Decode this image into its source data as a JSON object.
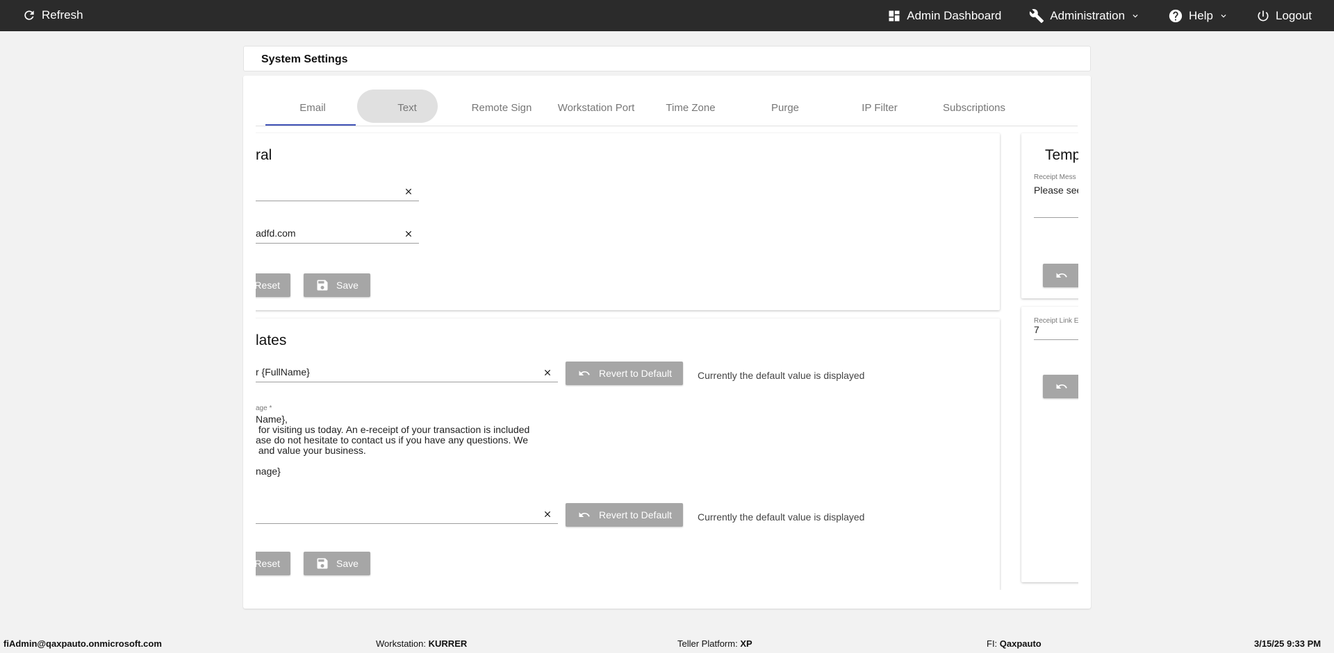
{
  "topbar": {
    "refresh": "Refresh",
    "admin_dashboard": "Admin Dashboard",
    "administration": "Administration",
    "help": "Help",
    "logout": "Logout"
  },
  "header": {
    "title": "System Settings"
  },
  "tabs": [
    {
      "label": "Email"
    },
    {
      "label": "Text"
    },
    {
      "label": "Remote Sign"
    },
    {
      "label": "Workstation Port"
    },
    {
      "label": "Time Zone"
    },
    {
      "label": "Purge"
    },
    {
      "label": "IP Filter"
    },
    {
      "label": "Subscriptions"
    }
  ],
  "general": {
    "title": "ral",
    "field1_value": "",
    "field2_value": "adfd.com",
    "reset": "Reset",
    "save": "Save"
  },
  "templates": {
    "title": "lates",
    "subject_value": "r {FullName}",
    "revert": "Revert to Default",
    "default_note": "Currently the default value is displayed",
    "message_label": "age *",
    "message_lines": [
      "Name},",
      " for visiting us today. An e-receipt of your transaction is included",
      "ase do not hesitate to contact us if you have any questions. We",
      " and value your business.",
      "",
      "nage}"
    ],
    "field3_value": "",
    "reset": "Reset",
    "save": "Save"
  },
  "right_panel": {
    "title": "Temp",
    "receipt_message_label": "Receipt Mess",
    "receipt_message_value": "Please see",
    "receipt_link_label": "Receipt Link E",
    "receipt_link_value": "7"
  },
  "footer": {
    "user": "fiAdmin@qaxpauto.onmicrosoft.com",
    "workstation_label": "Workstation:",
    "workstation_value": "KURRER",
    "teller_label": "Teller Platform:",
    "teller_value": "XP",
    "fi_label": "FI:",
    "fi_value": "Qaxpauto",
    "datetime": "3/15/25 9:33 PM"
  },
  "colors": {
    "topbar": "#2b2b2b",
    "accent": "#3f51b5",
    "button": "#a6a6a6"
  }
}
